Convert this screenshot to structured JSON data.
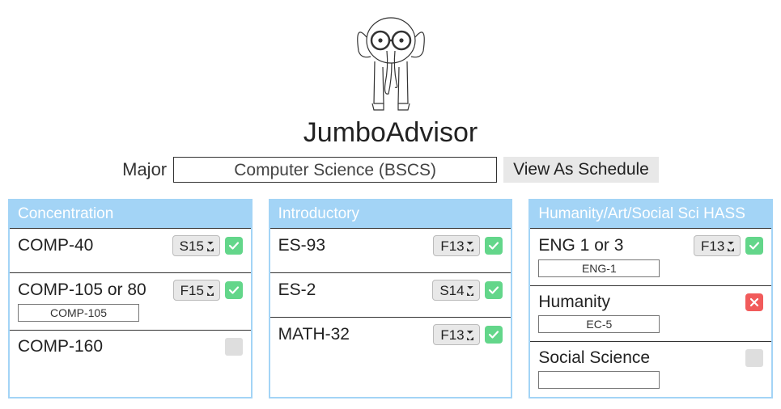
{
  "header": {
    "title": "JumboAdvisor",
    "major_label": "Major",
    "major_value": "Computer Science (BSCS)",
    "view_schedule_label": "View As Schedule"
  },
  "columns": [
    {
      "title": "Concentration",
      "rows": [
        {
          "name": "COMP-40",
          "term": "S15",
          "status": "check"
        },
        {
          "name": "COMP-105 or 80",
          "term": "F15",
          "status": "check",
          "sub": "COMP-105"
        },
        {
          "name": "COMP-160",
          "term": "",
          "status": "empty"
        }
      ]
    },
    {
      "title": "Introductory",
      "rows": [
        {
          "name": "ES-93",
          "term": "F13",
          "status": "check"
        },
        {
          "name": "ES-2",
          "term": "S14",
          "status": "check"
        },
        {
          "name": "MATH-32",
          "term": "F13",
          "status": "check"
        }
      ]
    },
    {
      "title": "Humanity/Art/Social Sci HASS",
      "rows": [
        {
          "name": "ENG 1 or 3",
          "term": "F13",
          "status": "check",
          "sub": "ENG-1"
        },
        {
          "name": "Humanity",
          "term": "",
          "status": "x",
          "sub": "EC-5"
        },
        {
          "name": "Social Science",
          "term": "",
          "status": "empty",
          "sub": ""
        }
      ]
    }
  ]
}
